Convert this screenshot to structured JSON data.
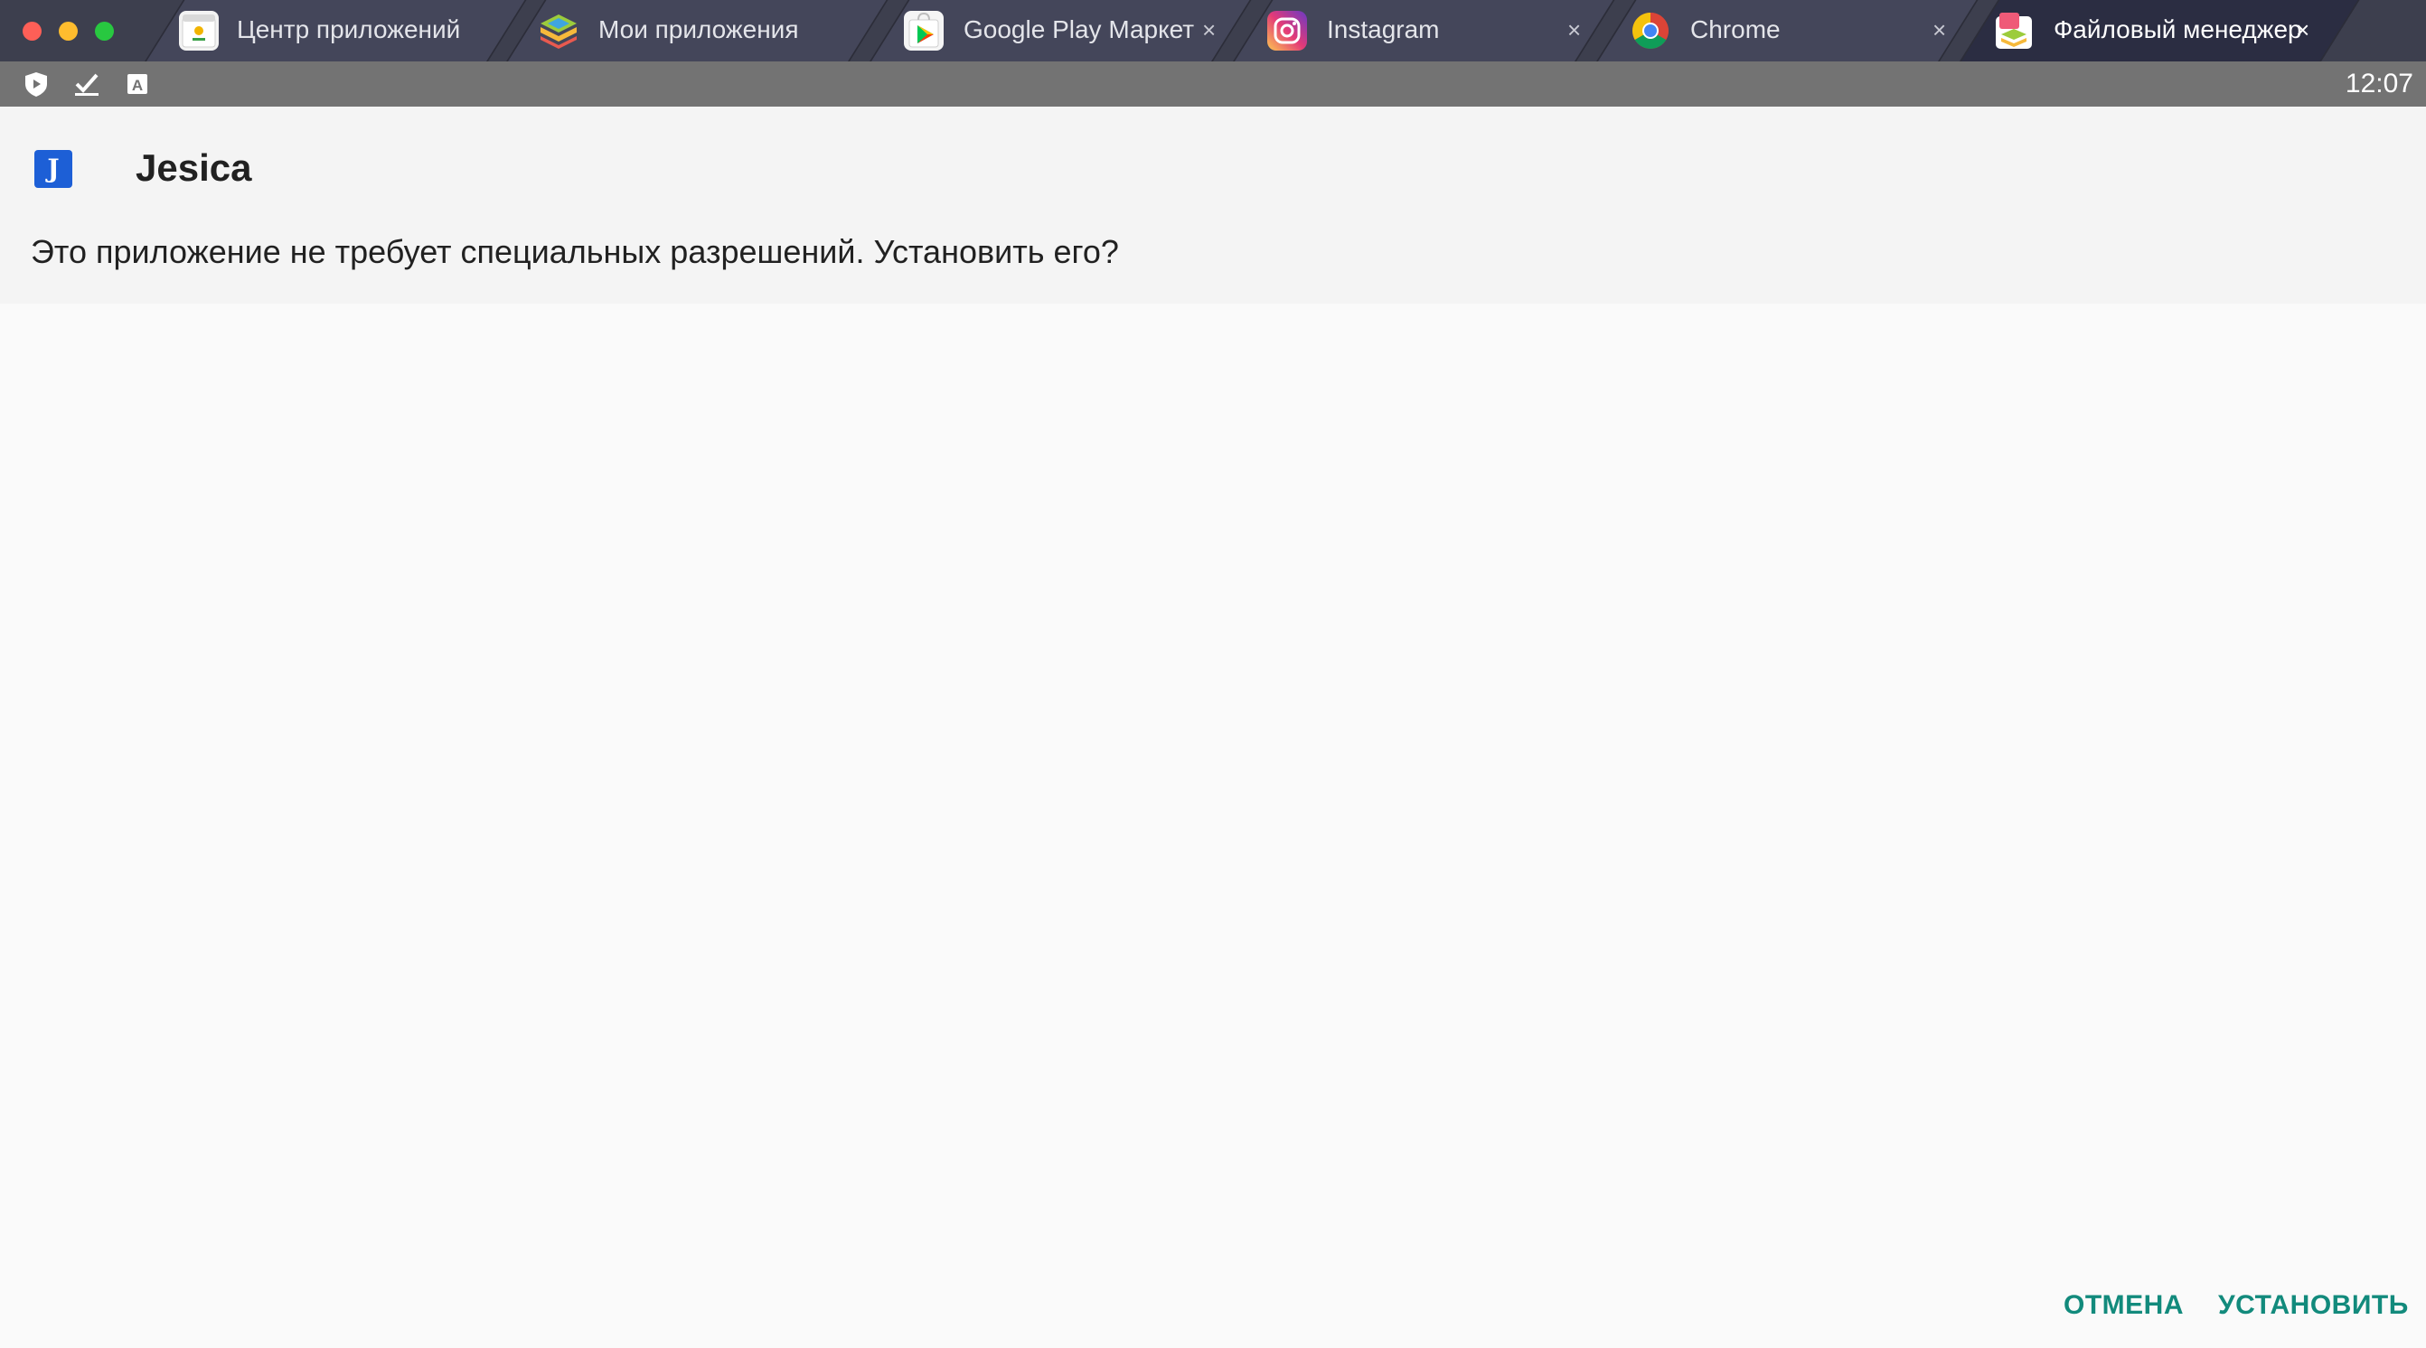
{
  "tabs": [
    {
      "label": "Центр приложений",
      "icon": "app-center-icon",
      "closable": false
    },
    {
      "label": "Мои приложения",
      "icon": "bluestacks-icon",
      "closable": false
    },
    {
      "label": "Google Play Маркет",
      "icon": "google-play-icon",
      "closable": true
    },
    {
      "label": "Instagram",
      "icon": "instagram-icon",
      "closable": true
    },
    {
      "label": "Chrome",
      "icon": "chrome-icon",
      "closable": true
    },
    {
      "label": "Файловый менеджер",
      "icon": "file-manager-icon",
      "closable": true,
      "active": true
    }
  ],
  "tab_close_glyph": "×",
  "status": {
    "icons": [
      "shield-icon",
      "checkmark-icon",
      "text-a-icon"
    ],
    "time": "12:07"
  },
  "dialog": {
    "app_icon_letter": "J",
    "app_name": "Jesica",
    "message": "Это приложение не требует специальных разрешений. Установить его?",
    "cancel_label": "ОТМЕНА",
    "install_label": "УСТАНОВИТЬ"
  },
  "colors": {
    "accent": "#128a7c",
    "tabbar": "#3d3f4e",
    "statusbar": "#737373",
    "app_icon": "#1d5fd6"
  }
}
